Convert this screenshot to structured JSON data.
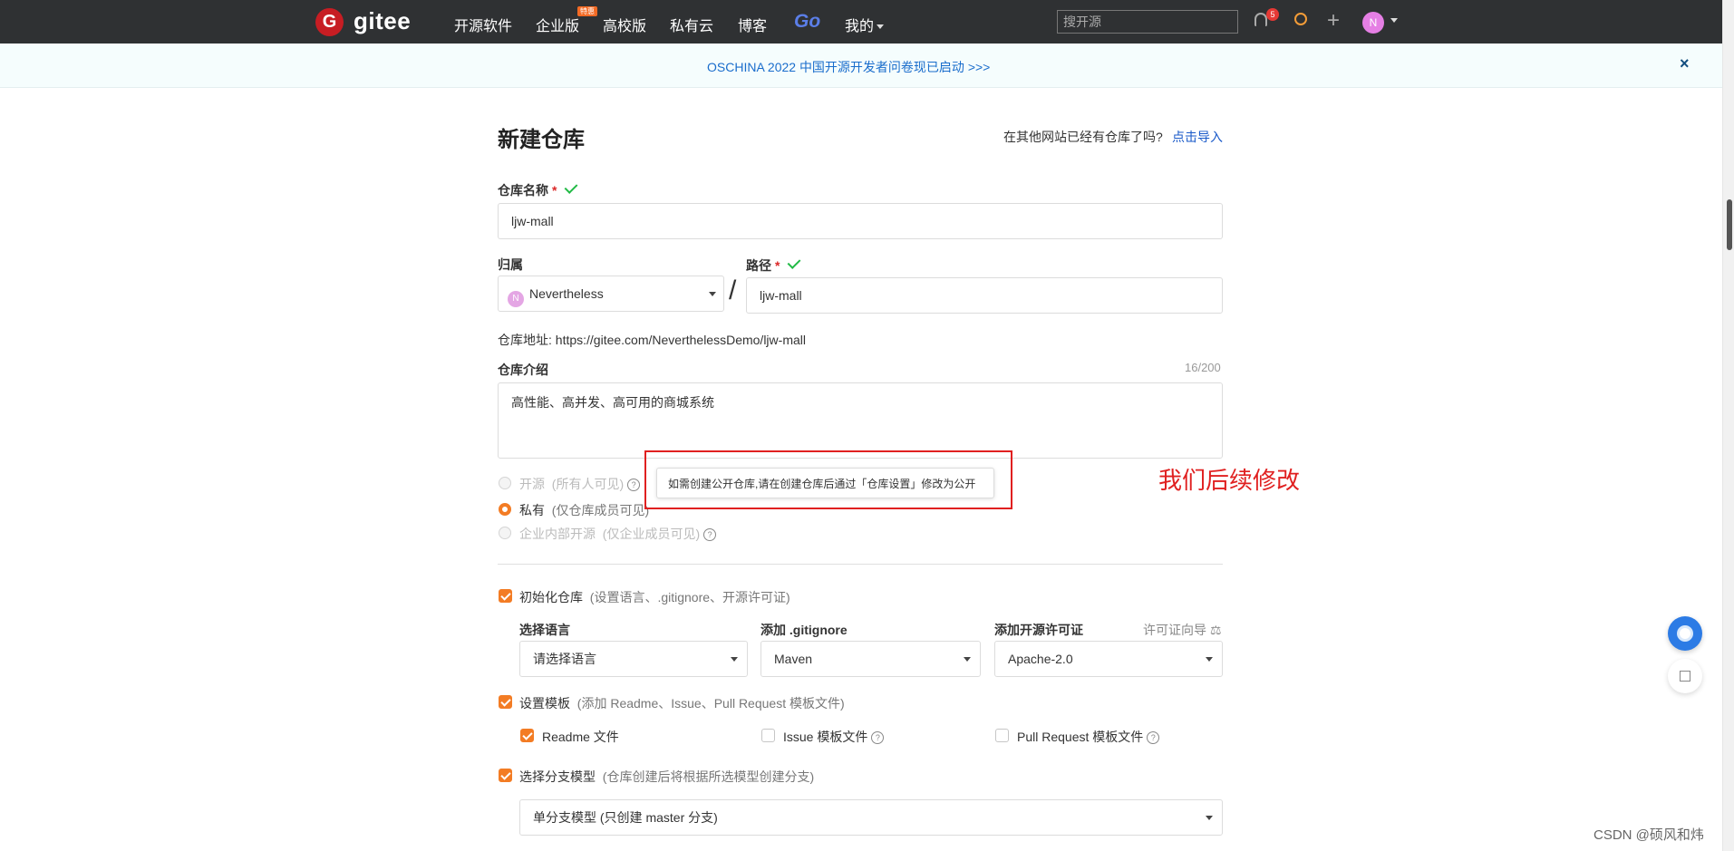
{
  "nav": {
    "logo_letter": "G",
    "logo_text": "gitee",
    "items": [
      "开源软件",
      "企业版",
      "高校版",
      "私有云",
      "博客"
    ],
    "enterprise_badge": "特惠",
    "go_label": "Go",
    "mine_label": "我的",
    "search_placeholder": "搜开源",
    "notification_count": "5",
    "avatar_letter": "N"
  },
  "banner": {
    "text": "OSCHINA 2022 中国开源开发者问卷现已启动 >>>",
    "close": "×"
  },
  "form": {
    "title": "新建仓库",
    "import_question": "在其他网站已经有仓库了吗?",
    "import_link": "点击导入",
    "repo_name_label": "仓库名称",
    "required_mark": "*",
    "repo_name_value": "ljw-mall",
    "owner_label": "归属",
    "owner_avatar": "N",
    "owner_value": "Nevertheless",
    "path_label": "路径",
    "path_value": "ljw-mall",
    "slash": "/",
    "repo_url_label": "仓库地址:",
    "repo_url_value": "https://gitee.com/NeverthelessDemo/ljw-mall",
    "intro_label": "仓库介绍",
    "intro_counter": "16/200",
    "intro_value": "高性能、高并发、高可用的商城系统",
    "visibility": {
      "public_label": "开源",
      "public_desc": "(所有人可见)",
      "private_label": "私有",
      "private_desc": "(仅仓库成员可见)",
      "internal_label": "企业内部开源",
      "internal_desc": "(仅企业成员可见)",
      "selected": "private"
    },
    "tooltip_text": "如需创建公开仓库,请在创建仓库后通过「仓库设置」修改为公开",
    "annotation": "我们后续修改",
    "init_repo": {
      "label": "初始化仓库",
      "desc": "(设置语言、.gitignore、开源许可证)",
      "checked": true
    },
    "language_label": "选择语言",
    "language_value": "请选择语言",
    "gitignore_label": "添加 .gitignore",
    "gitignore_value": "Maven",
    "license_label": "添加开源许可证",
    "license_guide": "许可证向导",
    "license_value": "Apache-2.0",
    "template": {
      "label": "设置模板",
      "desc": "(添加 Readme、Issue、Pull Request 模板文件)",
      "checked": true
    },
    "readme_label": "Readme 文件",
    "readme_checked": true,
    "issue_label": "Issue 模板文件",
    "issue_checked": false,
    "pr_label": "Pull Request 模板文件",
    "pr_checked": false,
    "branch": {
      "label": "选择分支模型",
      "desc": "(仓库创建后将根据所选模型创建分支)",
      "checked": true
    },
    "branch_model_value": "单分支模型 (只创建 master 分支)"
  },
  "watermark": "CSDN @硕风和炜",
  "colors": {
    "nav_bg": "#2f3133",
    "accent_orange": "#f37c24",
    "link_blue": "#1a5ac9",
    "annotation_red": "#e02020",
    "success_green": "#21ba45"
  },
  "icons": [
    "bell-icon",
    "bulb-icon",
    "plus-icon",
    "chevron-down-icon",
    "help-icon",
    "scale-icon",
    "check-icon",
    "close-icon",
    "edit-icon"
  ]
}
